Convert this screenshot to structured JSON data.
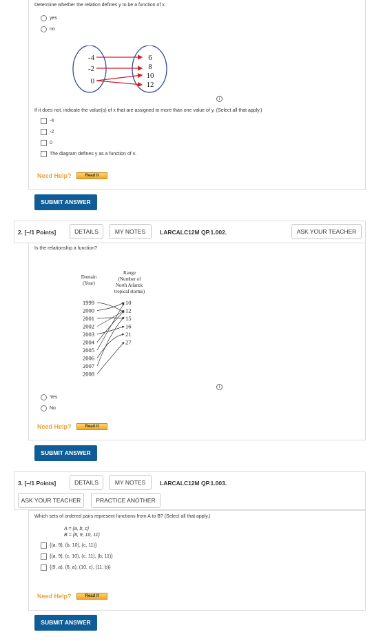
{
  "q1": {
    "prompt": "Determine whether the relation defines y to be a function of x.",
    "radio_options": [
      "yes",
      "no"
    ],
    "domain_values": [
      "-4",
      "-2",
      "0"
    ],
    "range_values": [
      "6",
      "8",
      "10",
      "12"
    ],
    "followup_prompt": "If it does not, indicate the value(s) of x that are assigned to more than one value of y. (Select all that apply.)",
    "checkbox_options": [
      "-4",
      "-2",
      "0",
      "The diagram defines y as a function of x."
    ],
    "need_help": "Need Help?",
    "read_it": "Read It",
    "submit": "SUBMIT ANSWER"
  },
  "q2": {
    "number": "2.  [–/1 Points]",
    "details": "DETAILS",
    "my_notes": "MY NOTES",
    "code": "LARCALC12M QP.1.002.",
    "ask_teacher": "ASK YOUR TEACHER",
    "prompt": "Is the relationship a function?",
    "domain_title_1": "Domain",
    "domain_title_2": "(Year)",
    "range_title_1": "Range",
    "range_title_2": "(Number of",
    "range_title_3": "North Atlantic",
    "range_title_4": "tropical storms)",
    "years": [
      "1999",
      "2000",
      "2001",
      "2002",
      "2003",
      "2004",
      "2005",
      "2006",
      "2007",
      "2008"
    ],
    "storms": [
      "10",
      "12",
      "15",
      "16",
      "21",
      "27"
    ],
    "radio_options": [
      "Yes",
      "No"
    ],
    "need_help": "Need Help?",
    "read_it": "Read It",
    "submit": "SUBMIT ANSWER"
  },
  "q3": {
    "number": "3.  [–/1 Points]",
    "details": "DETAILS",
    "my_notes": "MY NOTES",
    "code": "LARCALC12M QP.1.003.",
    "ask_teacher": "ASK YOUR TEACHER",
    "practice_another": "PRACTICE ANOTHER",
    "prompt": "Which sets of ordered pairs represent functions from A to B? (Select all that apply.)",
    "set_a": "A = {a, b, c}",
    "set_b": "B = {8, 9, 10, 11}",
    "checkbox_options": [
      "{(a, 9), (b, 10), (c, 11)}",
      "{(a, 9), (c, 10), (c, 11), (b, 11)}",
      "{(9, a), (8, a), (10, c), (11, b)}"
    ],
    "need_help": "Need Help?",
    "read_it": "Read It",
    "submit": "SUBMIT ANSWER"
  },
  "colors": {
    "accent_blue": "#0f5c97",
    "need_help_orange": "#e8a33a",
    "arrow_red": "#d21f2a",
    "oval_blue": "#2f4a9a"
  }
}
